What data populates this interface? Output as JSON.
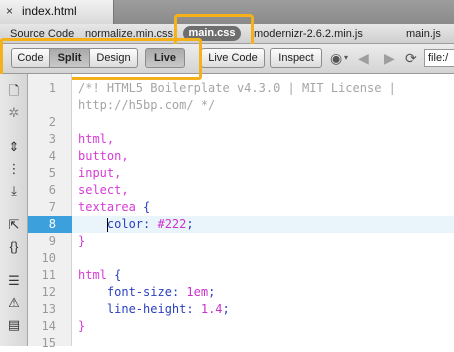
{
  "document_tab": {
    "close_glyph": "×",
    "filename": "index.html"
  },
  "related_files": {
    "items": [
      {
        "label": "Source Code",
        "active": false
      },
      {
        "label": "normalize.min.css",
        "active": false
      },
      {
        "label": "main.css",
        "active": true
      },
      {
        "label": "modernizr-2.6.2.min.js",
        "active": false
      },
      {
        "label": "main.js",
        "active": false
      }
    ]
  },
  "toolbar": {
    "views": {
      "code": "Code",
      "split": "Split",
      "design": "Design",
      "live": "Live"
    },
    "live_code": "Live Code",
    "inspect": "Inspect",
    "address_value": "file:/",
    "icons": [
      "globe-icon",
      "back-arrow-icon",
      "forward-arrow-icon",
      "refresh-icon"
    ]
  },
  "highlight_color": "#f4b11a",
  "coding_toolbar_icons": [
    "open-documents-icon",
    "collapse-tag-icon",
    "expand-all-icon",
    "collapse-full-tag-icon",
    "collapse-selection-icon",
    "select-parent-tag-icon",
    "balance-braces-icon",
    "line-numbers-icon",
    "highlight-invalid-code-icon",
    "apply-comment-icon"
  ],
  "editor": {
    "current_line": 8,
    "lines": [
      {
        "num": "1",
        "text": "/*! HTML5 Boilerplate v4.3.0 | MIT License |",
        "type": "comment"
      },
      {
        "num": "",
        "text": "http://h5bp.com/ */",
        "type": "comment"
      },
      {
        "num": "2",
        "text": "",
        "type": "blank"
      },
      {
        "num": "3",
        "text": "html,",
        "type": "selector"
      },
      {
        "num": "4",
        "text": "button,",
        "type": "selector"
      },
      {
        "num": "5",
        "text": "input,",
        "type": "selector"
      },
      {
        "num": "6",
        "text": "select,",
        "type": "selector"
      },
      {
        "num": "7",
        "text": "textarea {",
        "type": "selector"
      },
      {
        "num": "8",
        "prop": "color",
        "value": "#222",
        "type": "declaration"
      },
      {
        "num": "9",
        "text": "}",
        "type": "selector"
      },
      {
        "num": "10",
        "text": "",
        "type": "blank"
      },
      {
        "num": "11",
        "text": "html {",
        "type": "selector"
      },
      {
        "num": "12",
        "prop": "font-size",
        "value": "1em",
        "type": "declaration"
      },
      {
        "num": "13",
        "prop": "line-height",
        "value": "1.4",
        "type": "declaration"
      },
      {
        "num": "14",
        "text": "}",
        "type": "selector"
      },
      {
        "num": "15",
        "text": "",
        "type": "blank"
      }
    ]
  }
}
